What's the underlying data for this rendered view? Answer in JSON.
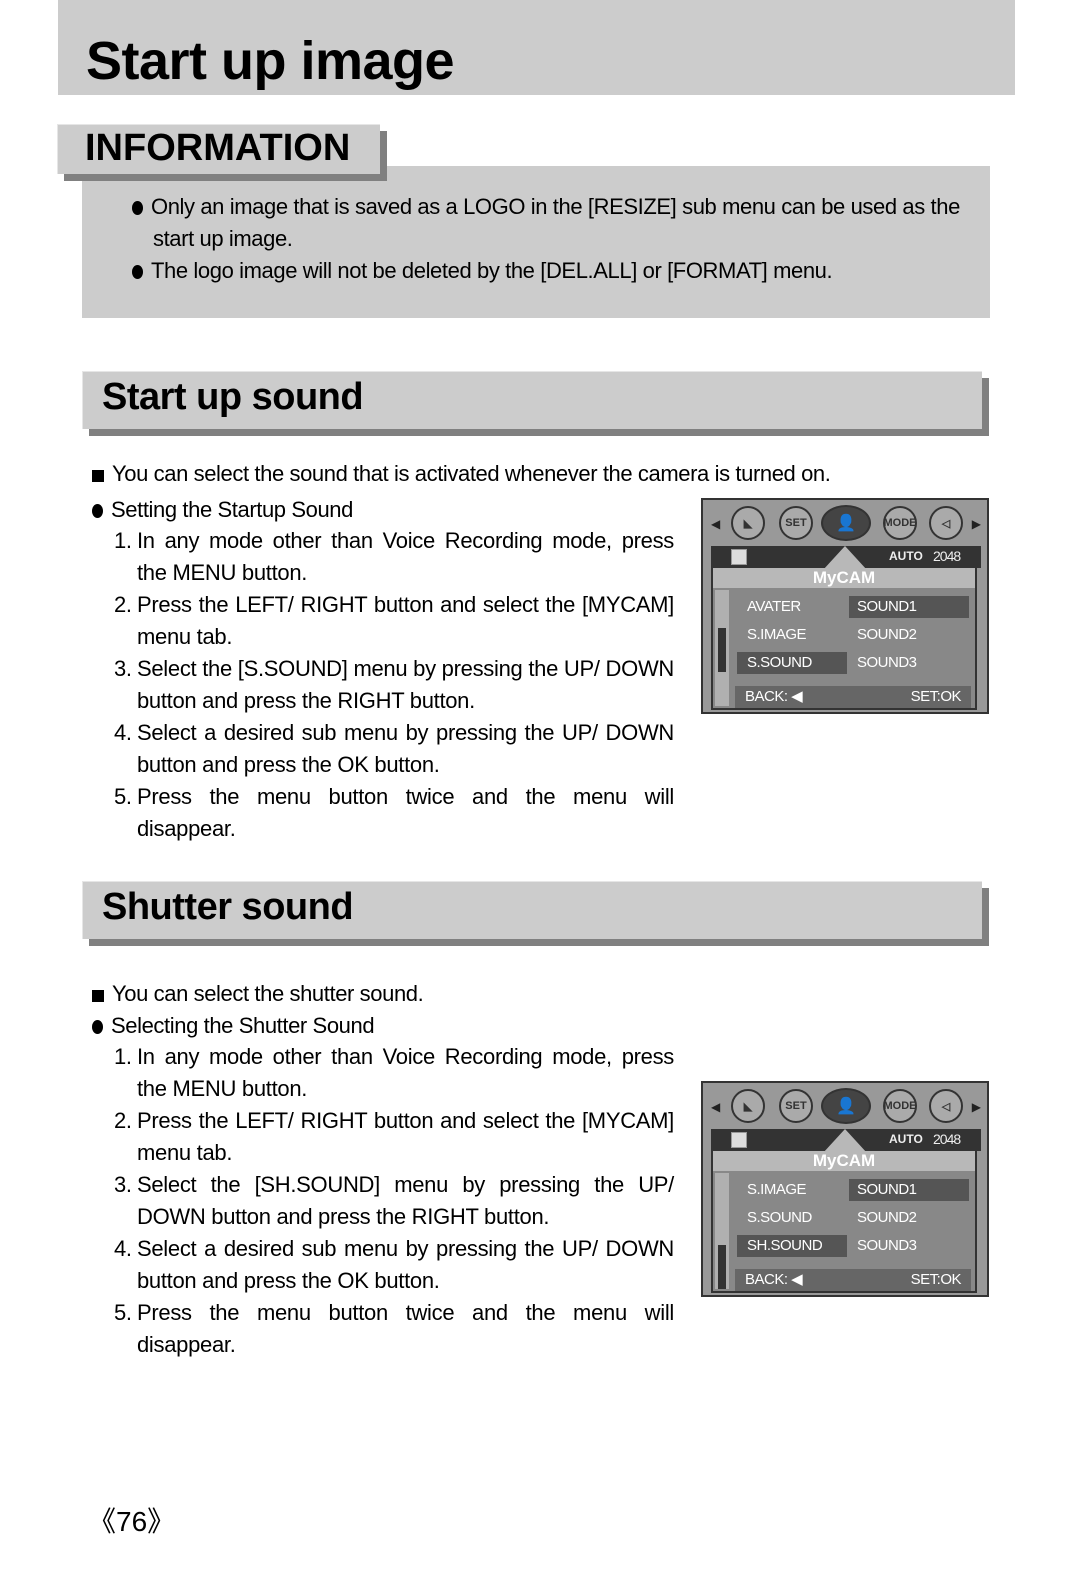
{
  "page_title": "Start up image",
  "information": {
    "tab_label": "INFORMATION",
    "bullets": [
      "Only an image that is saved as a LOGO in the [RESIZE] sub menu can be used as the",
      "start up image.",
      "The logo image will not be deleted by the [DEL.ALL] or [FORMAT] menu."
    ]
  },
  "startup_sound": {
    "heading": "Start up sound",
    "intro": "You can select the sound that is activated whenever the camera is turned on.",
    "subheading": "Setting the Startup Sound",
    "steps": [
      {
        "num": "1.",
        "text": "In any mode other than Voice Recording mode, press the MENU button."
      },
      {
        "num": "2.",
        "text": "Press the LEFT/ RIGHT button and select the [MYCAM] menu tab."
      },
      {
        "num": "3.",
        "text": "Select the [S.SOUND] menu by pressing the UP/ DOWN button and press the RIGHT button."
      },
      {
        "num": "4.",
        "text": "Select a desired sub menu by pressing the UP/ DOWN button and press the OK button."
      },
      {
        "num": "5.",
        "text": "Press the menu button twice and the menu will disappear."
      }
    ],
    "lcd": {
      "tabs": [
        "◣",
        "SET",
        "👤",
        "MODE",
        "◁"
      ],
      "status_auto": "AUTO",
      "status_res": "2048",
      "title": "MyCAM",
      "left_items": [
        "AVATER",
        "S.IMAGE",
        "S.SOUND"
      ],
      "right_items": [
        "SOUND1",
        "SOUND2",
        "SOUND3"
      ],
      "back": "BACK: ◀",
      "set": "SET:OK"
    }
  },
  "shutter_sound": {
    "heading": "Shutter sound",
    "intro": "You can select the shutter sound.",
    "subheading": "Selecting the Shutter Sound",
    "steps": [
      {
        "num": "1.",
        "text": "In any mode other than Voice Recording mode, press the MENU button."
      },
      {
        "num": "2.",
        "text": "Press the LEFT/ RIGHT button and select the [MYCAM] menu tab."
      },
      {
        "num": "3.",
        "text": "Select the [SH.SOUND] menu by pressing the UP/ DOWN button and press the RIGHT button."
      },
      {
        "num": "4.",
        "text": "Select a desired sub menu by pressing the UP/ DOWN button and press the OK button."
      },
      {
        "num": "5.",
        "text": "Press the menu button twice and the menu will disappear."
      }
    ],
    "lcd": {
      "tabs": [
        "◣",
        "SET",
        "👤",
        "MODE",
        "◁"
      ],
      "status_auto": "AUTO",
      "status_res": "2048",
      "title": "MyCAM",
      "left_items": [
        "S.IMAGE",
        "S.SOUND",
        "SH.SOUND"
      ],
      "right_items": [
        "SOUND1",
        "SOUND2",
        "SOUND3"
      ],
      "back": "BACK: ◀",
      "set": "SET:OK"
    }
  },
  "page_number": "《76》"
}
